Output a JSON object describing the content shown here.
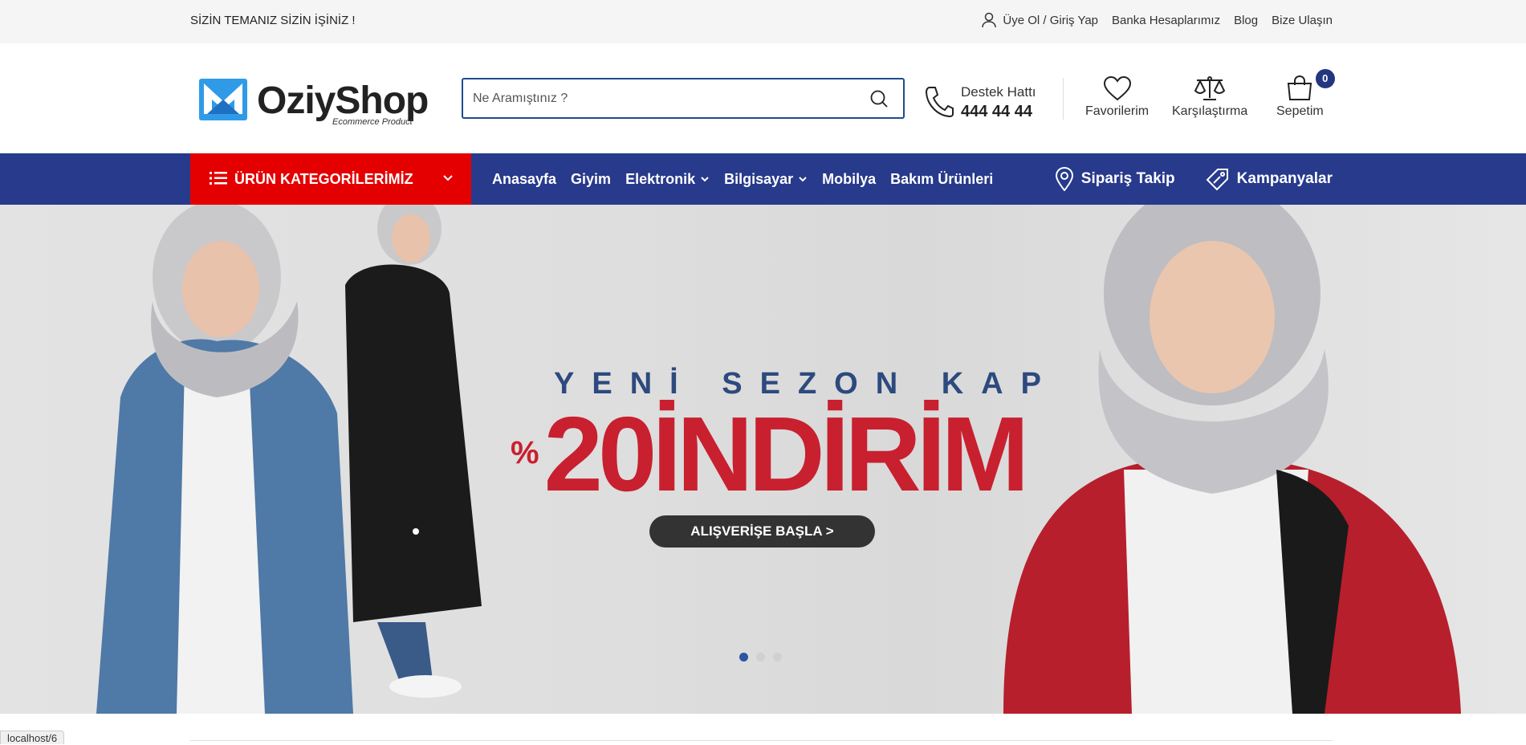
{
  "topbar": {
    "slogan": "SİZİN TEMANIZ SİZİN İŞİNİZ !",
    "login": "Üye Ol / Giriş Yap",
    "bank": "Banka Hesaplarımız",
    "blog": "Blog",
    "contact": "Bize Ulaşın"
  },
  "header": {
    "logo_name": "OziyShop",
    "logo_tag": "Ecommerce Product",
    "search_placeholder": "Ne Aramıştınız ?",
    "support_label": "Destek Hattı",
    "support_number": "444 44 44",
    "favorites": "Favorilerim",
    "compare": "Karşılaştırma",
    "cart": "Sepetim",
    "cart_count": "0"
  },
  "nav": {
    "categories": "ÜRÜN KATEGORİLERİMİZ",
    "items": [
      "Anasayfa",
      "Giyim",
      "Elektronik",
      "Bilgisayar",
      "Mobilya",
      "Bakım Ürünleri"
    ],
    "order_tracking": "Sipariş Takip",
    "campaigns": "Kampanyalar"
  },
  "hero": {
    "line1": "YENİ SEZON KAP",
    "percent": "%",
    "discount": "20",
    "word": "İNDİRİM",
    "cta": "ALIŞVERİŞE BAŞLA  >",
    "slides": 3,
    "active_slide": 1
  },
  "status_url": "localhost/6",
  "colors": {
    "navy": "#283a8c",
    "red": "#e40000",
    "headline_red": "#c8202f",
    "search_border": "#1e4b8c"
  }
}
